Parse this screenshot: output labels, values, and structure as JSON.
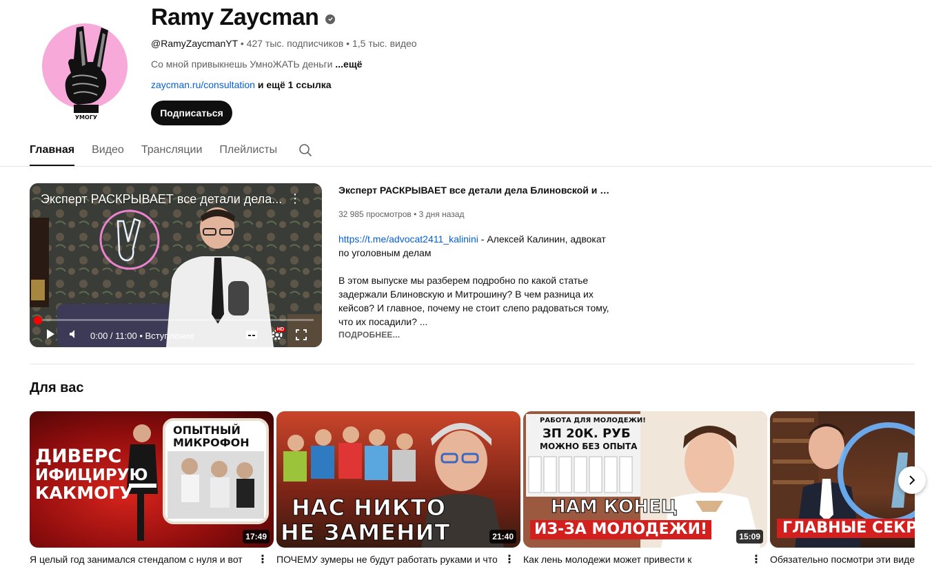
{
  "channel": {
    "name": "Ramy Zaycman",
    "handle": "@RamyZaycmanYT",
    "subscribers": "427 тыс. подписчиков",
    "videos": "1,5 тыс. видео",
    "separator": "•",
    "description": "Со мной привыкнешь УмноЖАТЬ деньги",
    "description_more": "...ещё",
    "link": "zaycman.ru/consultation",
    "links_more": "и ещё 1 ссылка",
    "subscribe_label": "Подписаться",
    "avatar_caption": "УМОГУ"
  },
  "tabs": [
    {
      "label": "Главная",
      "active": true
    },
    {
      "label": "Видео",
      "active": false
    },
    {
      "label": "Трансляции",
      "active": false
    },
    {
      "label": "Плейлисты",
      "active": false
    }
  ],
  "featured": {
    "overlay_title": "Эксперт РАСКРЫВАЕТ все детали дела...",
    "title": "Эксперт РАСКРЫВАЕТ все детали дела Блиновской и Мит...",
    "views": "32 985 просмотров",
    "age": "3 дня назад",
    "stats_sep": "•",
    "desc_link": "https://t.me/advocat2411_kalinini",
    "desc_line1": " - Алексей Калинин, адвокат по уголовным делам",
    "desc_para2": "В этом выпуске мы разберем подробно по какой статье задержали Блиновскую и Митрошину? В чем разница их кейсов? И главное, почему не стоит слепо радоваться тому, что их посадили? ...",
    "more_label": "ПОДРОБНЕЕ...",
    "time": "0:00 / 11:00",
    "chapter": "• Вступление",
    "hd": "HD",
    "progress": 0.0
  },
  "section": {
    "title": "Для вас"
  },
  "cards": [
    {
      "title": "Я целый год занимался стендапом с нуля и вот",
      "duration": "17:49",
      "thumb_lines": [
        "ДИВЕРС",
        "ИФИЦИРУЮ",
        "КАКМОГУ"
      ],
      "poster_lines": [
        "ОПЫТНЫЙ",
        "МИКРОФОН"
      ]
    },
    {
      "title": "ПОЧЕМУ зумеры не будут работать руками и что",
      "duration": "21:40",
      "thumb_lines": [
        "НАС НИКТО",
        "НЕ ЗАМЕНИТ"
      ]
    },
    {
      "title": "Как лень молодежи может привести к",
      "duration": "15:09",
      "thumb_lines": [
        "НАМ КОНЕЦ",
        "ИЗ-ЗА МОЛОДЕЖИ!"
      ],
      "poster_lines": [
        "РАБОТА ДЛЯ МОЛОДЕЖИ!",
        "ЗП 20К. РУБ",
        "МОЖНО БЕЗ ОПЫТА"
      ]
    },
    {
      "title": "Обязательно посмотри эти видео",
      "duration": "",
      "thumb_lines": [
        "ГЛАВНЫЕ СЕКРЕ"
      ]
    }
  ],
  "colors": {
    "avatar_bg": "#f7a9d9",
    "link": "#065fd4",
    "subscribe_bg": "#0f0f0f",
    "progress": "#ff0000"
  }
}
